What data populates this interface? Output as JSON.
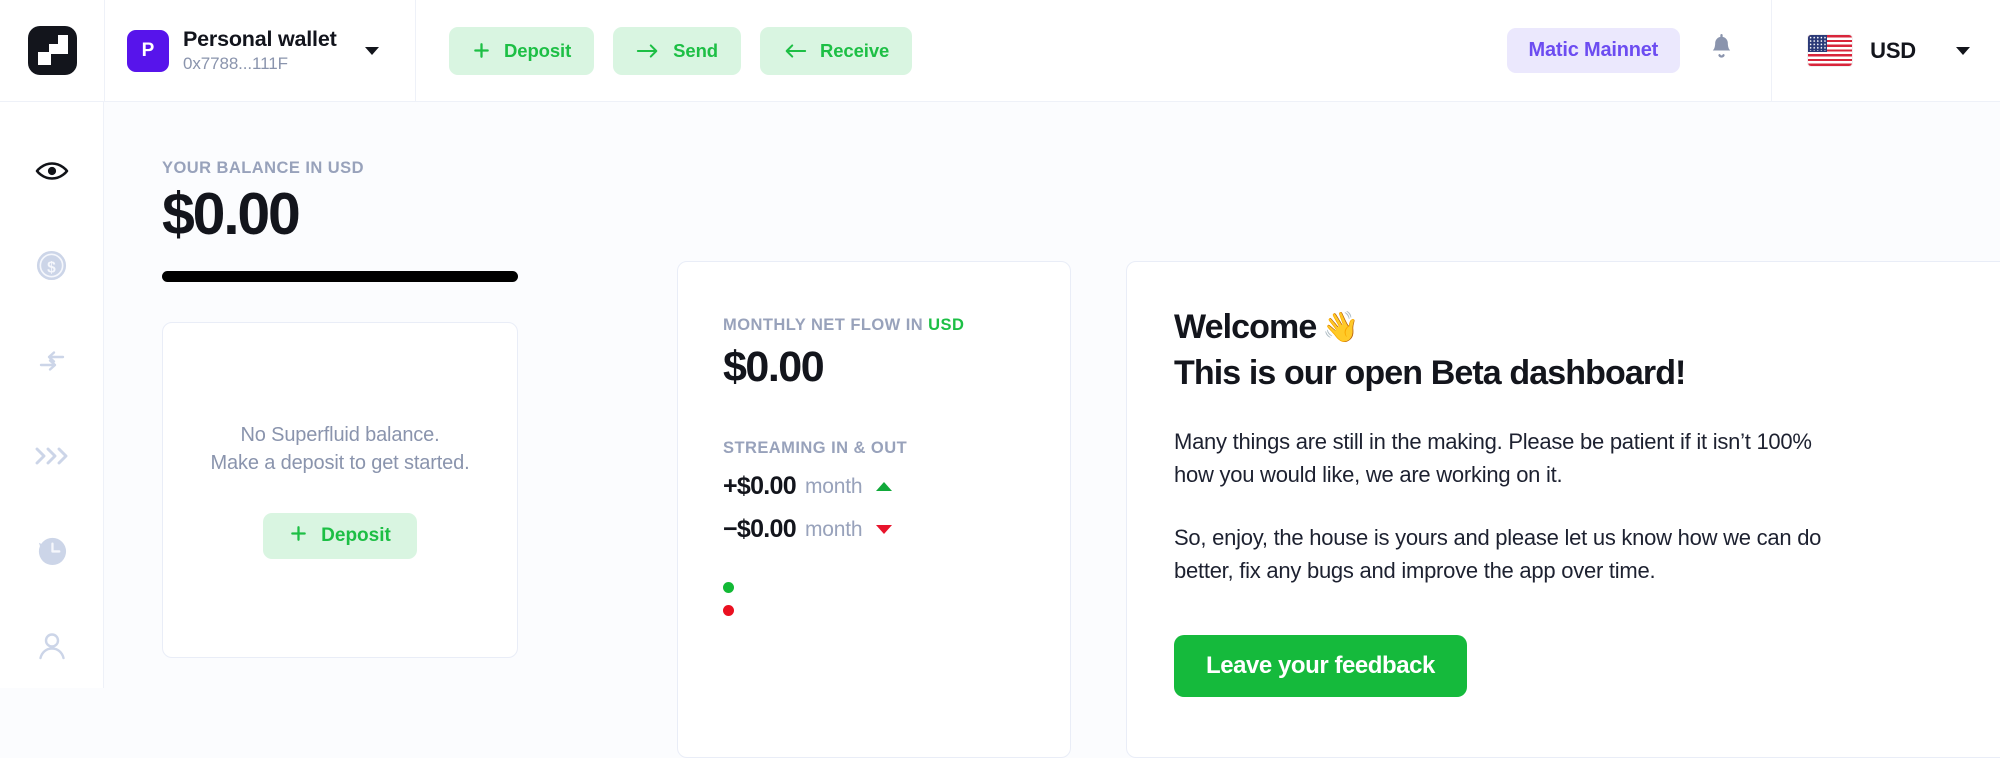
{
  "app": {
    "logo_icon": "superfluid-logo-icon"
  },
  "header": {
    "wallet": {
      "avatar_letter": "P",
      "name": "Personal wallet",
      "address": "0x7788...111F",
      "dropdown_icon": "chevron-down-icon"
    },
    "actions": [
      {
        "label": "Deposit",
        "icon": "plus-icon"
      },
      {
        "label": "Send",
        "icon": "arrow-right-icon"
      },
      {
        "label": "Receive",
        "icon": "arrow-left-icon"
      }
    ],
    "network": {
      "label": "Matic Mainnet"
    },
    "notifications": {
      "icon": "bell-icon"
    },
    "currency": {
      "flag_icon": "us-flag-icon",
      "label": "USD",
      "dropdown_icon": "chevron-down-icon"
    }
  },
  "sidebar": {
    "items": [
      {
        "icon": "eye-icon",
        "name": "dashboard",
        "active": true
      },
      {
        "icon": "dollar-coin-icon",
        "name": "tokens",
        "active": false
      },
      {
        "icon": "transfer-arrows-icon",
        "name": "transfers",
        "active": false
      },
      {
        "icon": "chevrons-right-icon",
        "name": "streams",
        "active": false
      },
      {
        "icon": "history-clock-icon",
        "name": "history",
        "active": false
      },
      {
        "icon": "person-icon",
        "name": "account",
        "active": false
      }
    ]
  },
  "balance": {
    "label_prefix": "YOUR BALANCE IN ",
    "label_currency": "USD",
    "amount": "$0.00",
    "bar_color": "#000000"
  },
  "empty_state": {
    "line1": "No Superfluid balance.",
    "line2": "Make a deposit to get started.",
    "deposit_label": "Deposit",
    "deposit_icon": "plus-icon"
  },
  "net_flow": {
    "label_prefix": "MONTHLY NET FLOW IN ",
    "label_currency": "USD",
    "label_currency_color": "#1dbf45",
    "amount": "$0.00",
    "streaming_label": "STREAMING IN & OUT",
    "rows": [
      {
        "value": "+$0.00",
        "unit": "month",
        "direction": "up",
        "color": "#11a93a",
        "icon": "triangle-up-icon"
      },
      {
        "value": "−$0.00",
        "unit": "month",
        "direction": "down",
        "color": "#e8142c",
        "icon": "triangle-down-icon"
      }
    ],
    "legend": [
      {
        "name": "inflow-dot",
        "color": "#12b935"
      },
      {
        "name": "outflow-dot",
        "color": "#ea1020"
      }
    ]
  },
  "welcome": {
    "heading": "Welcome",
    "heading_emoji": "👋",
    "subheading": "This is our open Beta dashboard!",
    "paragraph1": "Many things are still in the making. Please be patient if it isn’t 100% how you would like, we are working on it.",
    "paragraph2": "So, enjoy, the house is yours and please let us know how we can do better, fix any bugs and improve the app over time.",
    "cta_label": "Leave your feedback",
    "cta_color": "#15ba3c"
  }
}
